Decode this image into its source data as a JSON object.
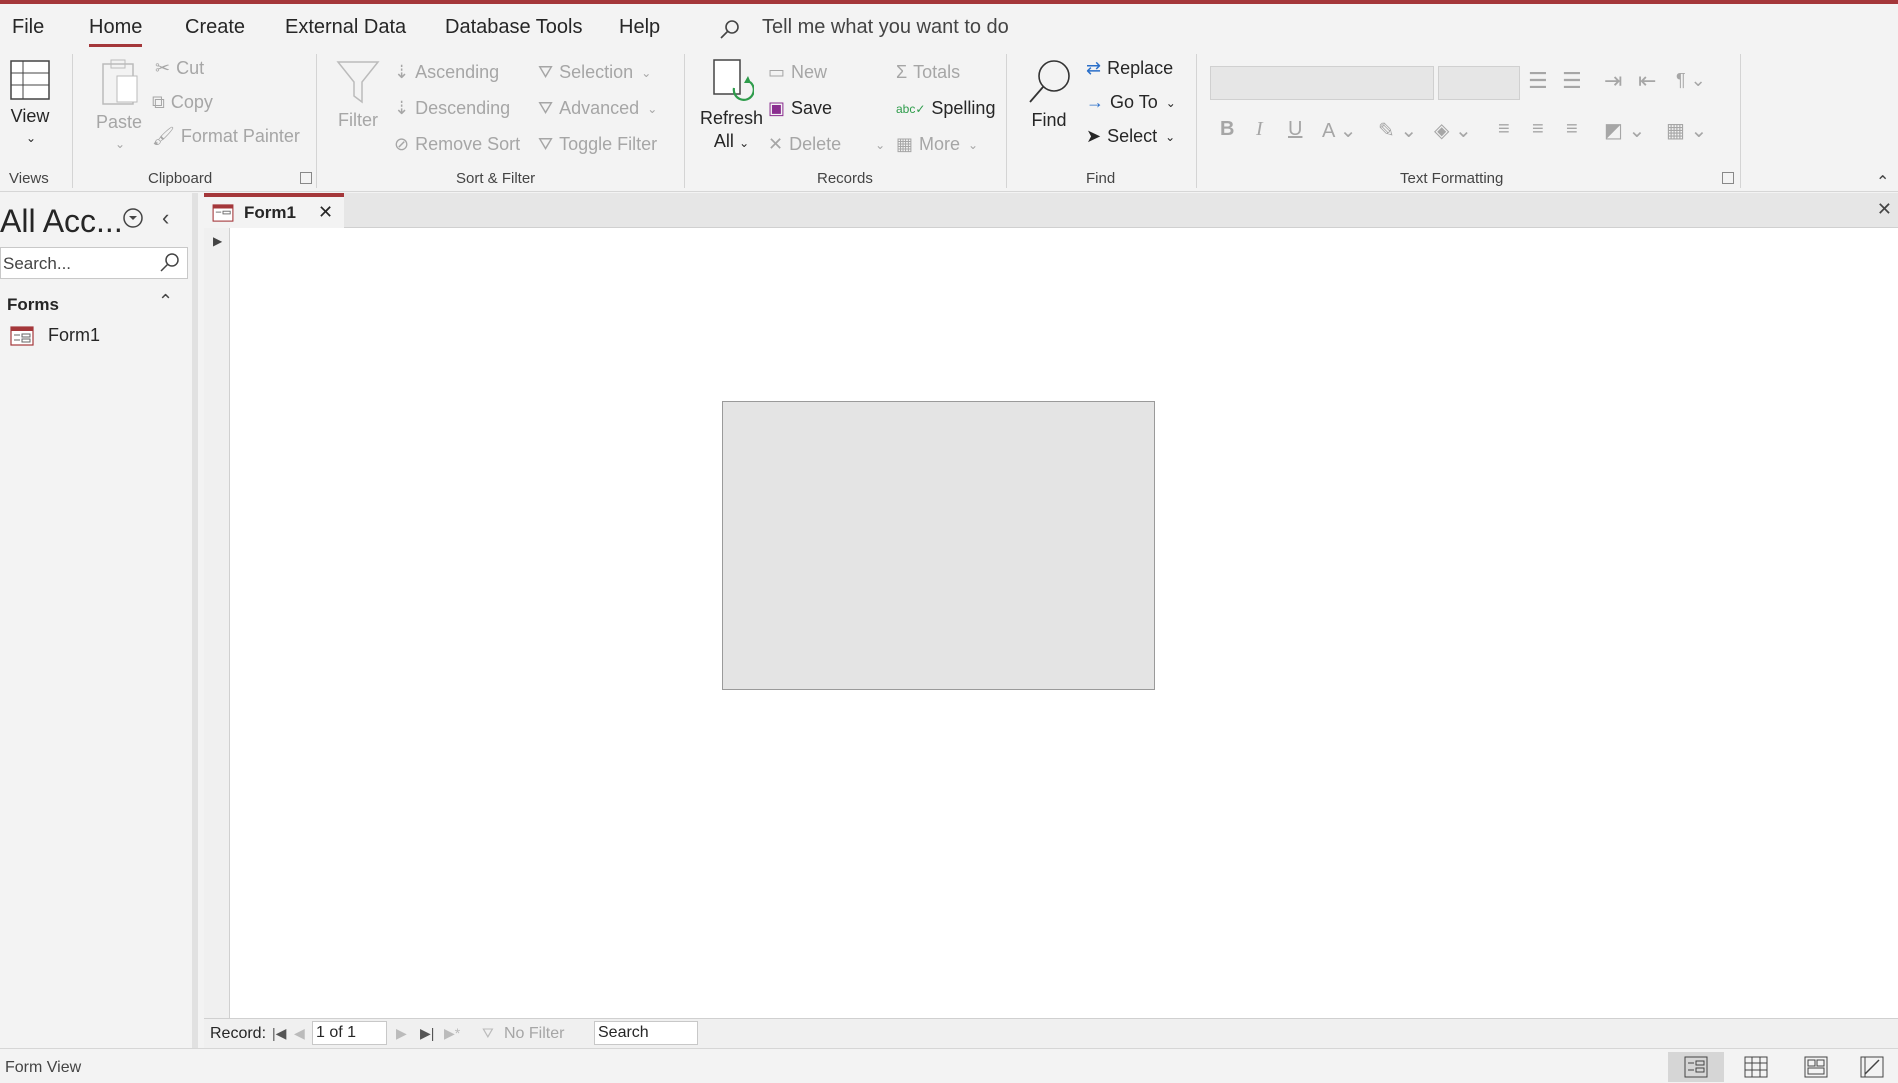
{
  "menu": {
    "tabs": [
      {
        "label": "File"
      },
      {
        "label": "Home"
      },
      {
        "label": "Create"
      },
      {
        "label": "External Data"
      },
      {
        "label": "Database Tools"
      },
      {
        "label": "Help"
      }
    ],
    "active_tab": "Home",
    "tellme": "Tell me what you want to do"
  },
  "ribbon": {
    "views": {
      "view": "View",
      "label": "Views"
    },
    "clipboard": {
      "paste": "Paste",
      "cut": "Cut",
      "copy": "Copy",
      "format_painter": "Format Painter",
      "label": "Clipboard"
    },
    "sort_filter": {
      "filter": "Filter",
      "ascending": "Ascending",
      "descending": "Descending",
      "remove_sort": "Remove Sort",
      "selection": "Selection",
      "advanced": "Advanced",
      "toggle_filter": "Toggle Filter",
      "label": "Sort & Filter"
    },
    "records": {
      "refresh": "Refresh",
      "refresh_all": "All",
      "new": "New",
      "save": "Save",
      "delete": "Delete",
      "totals": "Totals",
      "spelling": "Spelling",
      "more": "More",
      "label": "Records"
    },
    "find": {
      "find": "Find",
      "replace": "Replace",
      "goto": "Go To",
      "select": "Select",
      "label": "Find"
    },
    "text_formatting": {
      "bold": "B",
      "italic": "I",
      "underline": "U",
      "label": "Text Formatting"
    }
  },
  "nav": {
    "title": "All Acc...",
    "search_placeholder": "Search...",
    "section": "Forms",
    "items": [
      {
        "label": "Form1"
      }
    ]
  },
  "document": {
    "tab_label": "Form1"
  },
  "record_bar": {
    "label": "Record:",
    "position": "1 of 1",
    "no_filter": "No Filter",
    "search": "Search"
  },
  "status": {
    "text": "Form View"
  },
  "colors": {
    "accent": "#a4373a"
  }
}
